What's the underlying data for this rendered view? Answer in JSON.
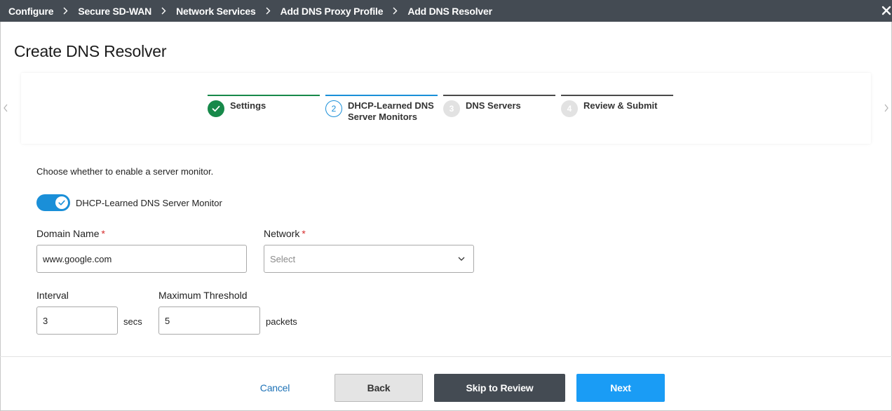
{
  "breadcrumb": {
    "items": [
      "Configure",
      "Secure SD-WAN",
      "Network Services",
      "Add DNS Proxy Profile",
      "Add DNS Resolver"
    ]
  },
  "page": {
    "title": "Create DNS Resolver"
  },
  "stepper": {
    "steps": [
      {
        "number": "1",
        "label": "Settings",
        "state": "done"
      },
      {
        "number": "2",
        "label": "DHCP-Learned DNS Server Monitors",
        "state": "active"
      },
      {
        "number": "3",
        "label": "DNS Servers",
        "state": "pending"
      },
      {
        "number": "4",
        "label": "Review & Submit",
        "state": "pending"
      }
    ]
  },
  "form": {
    "intro": "Choose whether to enable a server monitor.",
    "toggle": {
      "label": "DHCP-Learned DNS Server Monitor",
      "enabled": true
    },
    "domain": {
      "label": "Domain Name",
      "required_mark": "*",
      "value": "www.google.com"
    },
    "network": {
      "label": "Network",
      "required_mark": "*",
      "placeholder": "Select"
    },
    "interval": {
      "label": "Interval",
      "value": "3",
      "unit": "secs"
    },
    "threshold": {
      "label": "Maximum Threshold",
      "value": "5",
      "unit": "packets"
    }
  },
  "footer": {
    "cancel": "Cancel",
    "back": "Back",
    "skip": "Skip to Review",
    "next": "Next"
  },
  "colors": {
    "topbar": "#444b53",
    "accent": "#1a8fd8",
    "success": "#17894a",
    "primary_button": "#1a9cf5"
  }
}
